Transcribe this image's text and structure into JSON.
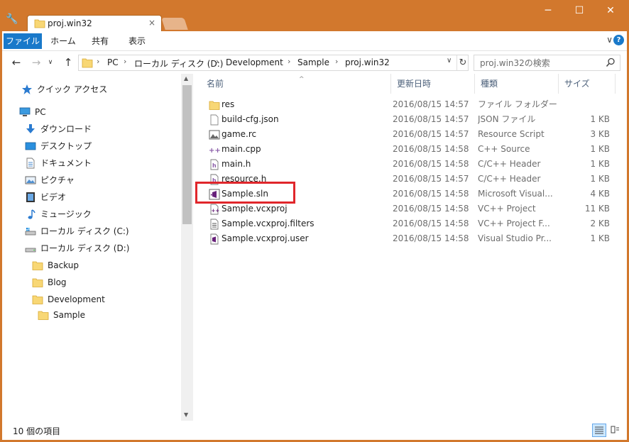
{
  "window": {
    "tab_title": "proj.win32",
    "tab_close": "×",
    "minimize": "─",
    "maximize": "☐",
    "close": "✕",
    "accent": "#d2782d"
  },
  "ribbon": {
    "tabs": [
      "ファイル",
      "ホーム",
      "共有",
      "表示"
    ],
    "expand": "∨",
    "help": "?"
  },
  "nav": {
    "back": "←",
    "forward": "→",
    "dropdown": "∨",
    "up": "↑"
  },
  "address": {
    "crumbs": [
      "PC",
      "ローカル ディスク (D:)",
      "Development",
      "Sample",
      "proj.win32"
    ],
    "separator": "›",
    "dropdown": "∨",
    "refresh": "↻"
  },
  "search": {
    "placeholder": "proj.win32の検索"
  },
  "sidebar": {
    "items": [
      {
        "label": "クイック アクセス",
        "icon": "quick-access-icon"
      },
      {
        "label": "PC",
        "icon": "pc-icon"
      },
      {
        "label": "ダウンロード",
        "icon": "download-icon"
      },
      {
        "label": "デスクトップ",
        "icon": "desktop-icon"
      },
      {
        "label": "ドキュメント",
        "icon": "document-icon"
      },
      {
        "label": "ピクチャ",
        "icon": "pictures-icon"
      },
      {
        "label": "ビデオ",
        "icon": "video-icon"
      },
      {
        "label": "ミュージック",
        "icon": "music-icon"
      },
      {
        "label": "ローカル ディスク (C:)",
        "icon": "drive-icon"
      },
      {
        "label": "ローカル ディスク (D:)",
        "icon": "drive-icon"
      },
      {
        "label": "Backup",
        "icon": "folder-icon"
      },
      {
        "label": "Blog",
        "icon": "folder-icon"
      },
      {
        "label": "Development",
        "icon": "folder-icon"
      },
      {
        "label": "Sample",
        "icon": "folder-icon"
      }
    ]
  },
  "columns": {
    "name": "名前",
    "date": "更新日時",
    "type": "種類",
    "size": "サイズ",
    "sort_indicator": "^"
  },
  "files": [
    {
      "name": "res",
      "date": "2016/08/15 14:57",
      "type": "ファイル フォルダー",
      "size": "",
      "icon": "folder-icon"
    },
    {
      "name": "build-cfg.json",
      "date": "2016/08/15 14:57",
      "type": "JSON ファイル",
      "size": "1 KB",
      "icon": "blank-file-icon"
    },
    {
      "name": "game.rc",
      "date": "2016/08/15 14:57",
      "type": "Resource Script",
      "size": "3 KB",
      "icon": "resource-script-icon"
    },
    {
      "name": "main.cpp",
      "date": "2016/08/15 14:58",
      "type": "C++ Source",
      "size": "1 KB",
      "icon": "cpp-source-icon"
    },
    {
      "name": "main.h",
      "date": "2016/08/15 14:58",
      "type": "C/C++ Header",
      "size": "1 KB",
      "icon": "header-file-icon"
    },
    {
      "name": "resource.h",
      "date": "2016/08/15 14:57",
      "type": "C/C++ Header",
      "size": "1 KB",
      "icon": "header-file-icon"
    },
    {
      "name": "Sample.sln",
      "date": "2016/08/15 14:58",
      "type": "Microsoft Visual...",
      "size": "4 KB",
      "icon": "visual-studio-solution-icon"
    },
    {
      "name": "Sample.vcxproj",
      "date": "2016/08/15 14:58",
      "type": "VC++ Project",
      "size": "11 KB",
      "icon": "vcxproj-icon"
    },
    {
      "name": "Sample.vcxproj.filters",
      "date": "2016/08/15 14:58",
      "type": "VC++ Project F...",
      "size": "2 KB",
      "icon": "filters-file-icon"
    },
    {
      "name": "Sample.vcxproj.user",
      "date": "2016/08/15 14:58",
      "type": "Visual Studio Pr...",
      "size": "1 KB",
      "icon": "vcxproj-user-icon"
    }
  ],
  "status": {
    "item_count": "10 個の項目"
  },
  "highlight_color": "#e0262b"
}
